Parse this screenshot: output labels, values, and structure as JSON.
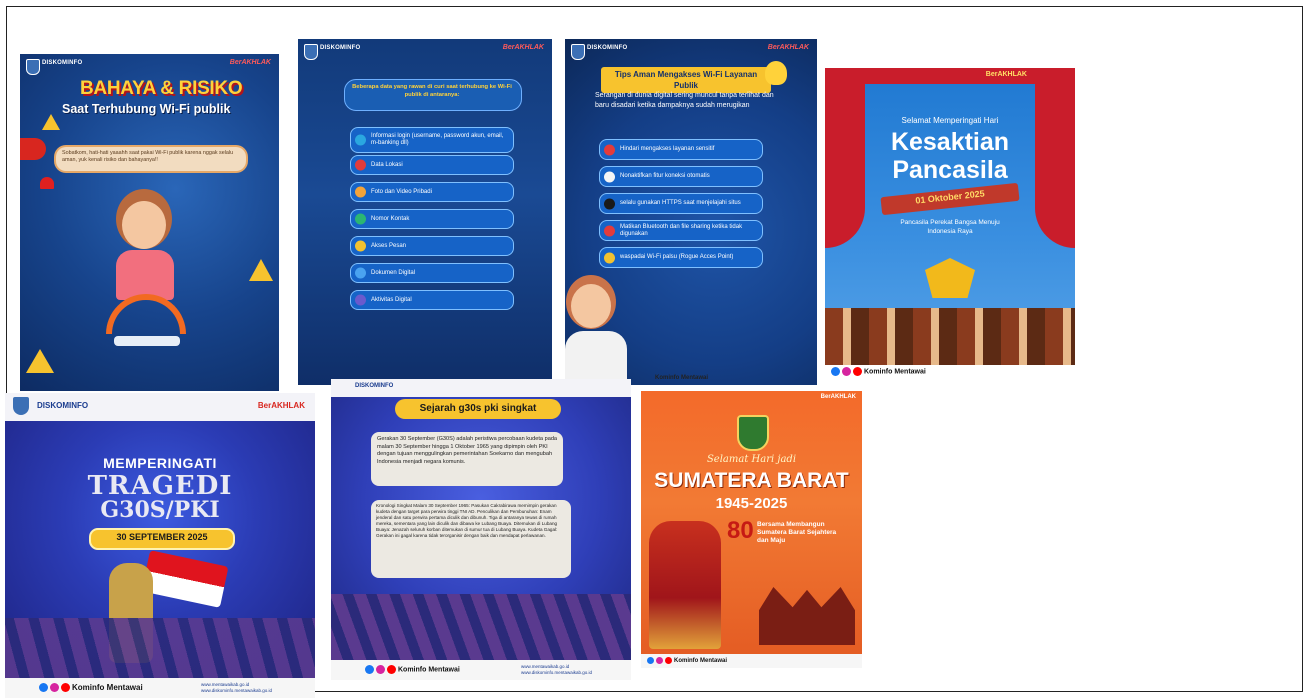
{
  "p1": {
    "header_logo": "DISKOMINFO",
    "brand": "BerAKHLAK",
    "title": "BAHAYA & RISIKO",
    "subtitle": "Saat Terhubung Wi-Fi publik",
    "body": "Sobatkom, hati-hati yaaahh saat pakai Wi-Fi publik karena nggak selalu aman, yuk kenali risiko dan bahayanya!!"
  },
  "p2": {
    "header_logo": "DISKOMINFO",
    "brand": "BerAKHLAK",
    "intro": "Beberapa data yang rawan di curi saat terhubung ke Wi-Fi publik di antaranya:",
    "items": [
      "Informasi login (username, password akun, email, m-banking dll)",
      "Data Lokasi",
      "Foto dan Video Pribadi",
      "Nomor Kontak",
      "Akses Pesan",
      "Dokumen Digital",
      "Aktivitas Digital"
    ]
  },
  "p3": {
    "header_logo": "DISKOMINFO",
    "brand": "BerAKHLAK",
    "title": "Tips Aman Mengakses Wi-Fi Layanan Publik",
    "intro": "Serangan di dunia digital sering muncul tanpa terlihat  dan baru disadari ketika dampaknya sudah merugikan",
    "items": [
      "Hindari mengakses layanan sensitif",
      "Nonaktifkan fitur koneksi otomatis",
      "selalu gunakan  HTTPS saat menjelajahi situs",
      "Matikan Bluetooth dan file sharing ketika tidak digunakan",
      "waspadai Wi-Fi palsu (Rogue Acces Point)"
    ],
    "footer": "Kominfo Mentawai"
  },
  "p4": {
    "brand": "BerAKHLAK",
    "greeting": "Selamat Memperingati Hari",
    "title_line1": "Kesaktian",
    "title_line2": "Pancasila",
    "date": "01 Oktober 2025",
    "tagline": "Pancasila Perekat Bangsa Menuju Indonesia Raya",
    "footer": "Kominfo Mentawai"
  },
  "p5": {
    "header_logo": "DISKOMINFO",
    "brand": "BerAKHLAK",
    "line1": "MEMPERINGATI",
    "line2": "TRAGEDI",
    "line3": "G30S/PKI",
    "date": "30 SEPTEMBER 2025",
    "footer": "Kominfo Mentawai",
    "web1": "www.mentawaikab.go.id",
    "web2": "www.diskominfo.mentawaikab.go.id"
  },
  "p6": {
    "header_logo": "DISKOMINFO",
    "title": "Sejarah g30s pki singkat",
    "para1": "Gerakan 30 September (G30S) adalah peristiwa percobaan kudeta pada malam 30 September hingga 1 Oktober 1965 yang dipimpin oleh PKI dengan tujuan menggulingkan pemerintahan Soekarno dan mengubah Indonesia menjadi negara komunis.",
    "para2": "Kronologi Singkat Malam 30 September 1965: Pasukan Cakrabirawa memimpin gerakan kudeta dengan target para perwira tinggi TNI AD. Penculikan dan Pembunuhan: Enam jenderal dan satu perwira pertama diculik dan dibunuh. Tiga di antaranya tewas di rumah mereka, sementara yang lain diculik dan dibawa ke Lubang Buaya. Ditemukan di Lubang Buaya: Jenazah seluruh korban ditemukan di sumur tua di Lubang Buaya. Kudeta Gagal: Gerakan ini gagal karena tidak terorganisir dengan baik dan mendapat perlawanan.",
    "footer": "Kominfo Mentawai",
    "web1": "www.mentawaikab.go.id",
    "web2": "www.diskominfo.mentawaikab.go.id"
  },
  "p7": {
    "brand": "BerAKHLAK",
    "script": "Selamat Hari jadi",
    "title": "SUMATERA BARAT",
    "years": "1945-2025",
    "anniv": "80",
    "tagline": "Bersama Membangun Sumatera Barat Sejahtera dan Maju",
    "footer": "Kominfo Mentawai"
  },
  "colors": {
    "navy": "#0e2f6e",
    "blue": "#1c4e9c",
    "orange": "#f26a21",
    "yellow": "#f7c32e",
    "red": "#d8261f"
  }
}
